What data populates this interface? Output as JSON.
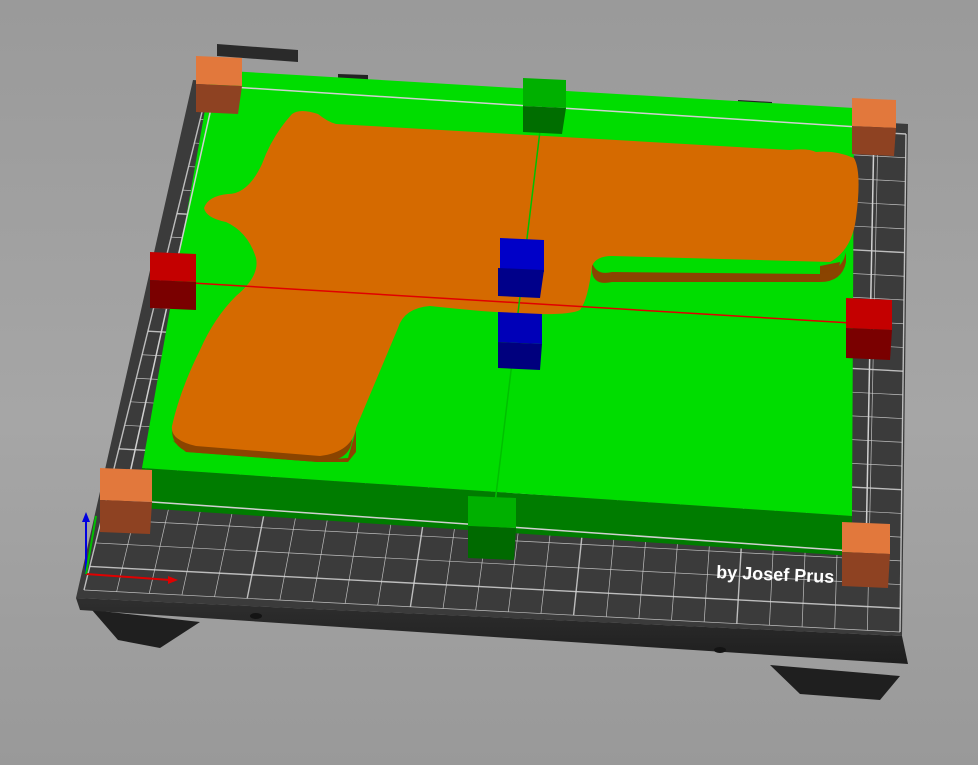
{
  "viewport": {
    "bed_brand_text": "by Josef Prus",
    "colors": {
      "background": "#9d9d9d",
      "bed_top": "#3a3a3a",
      "bed_side": "#262626",
      "grid_line": "#d8d8d8",
      "plate_top": "#00dd00",
      "plate_side": "#007a00",
      "model_top": "#d66a00",
      "model_side": "#8a4400",
      "handle_scale_corner": "#e07840",
      "handle_x_axis": "#c00000",
      "handle_y_axis": "#00a800",
      "handle_z_axis": "#0000c0",
      "axis_x": "#e00000",
      "axis_y": "#00c000",
      "axis_z": "#0000e0"
    },
    "icons": {
      "axis_triad": "xyz-axis-triad-icon"
    }
  }
}
